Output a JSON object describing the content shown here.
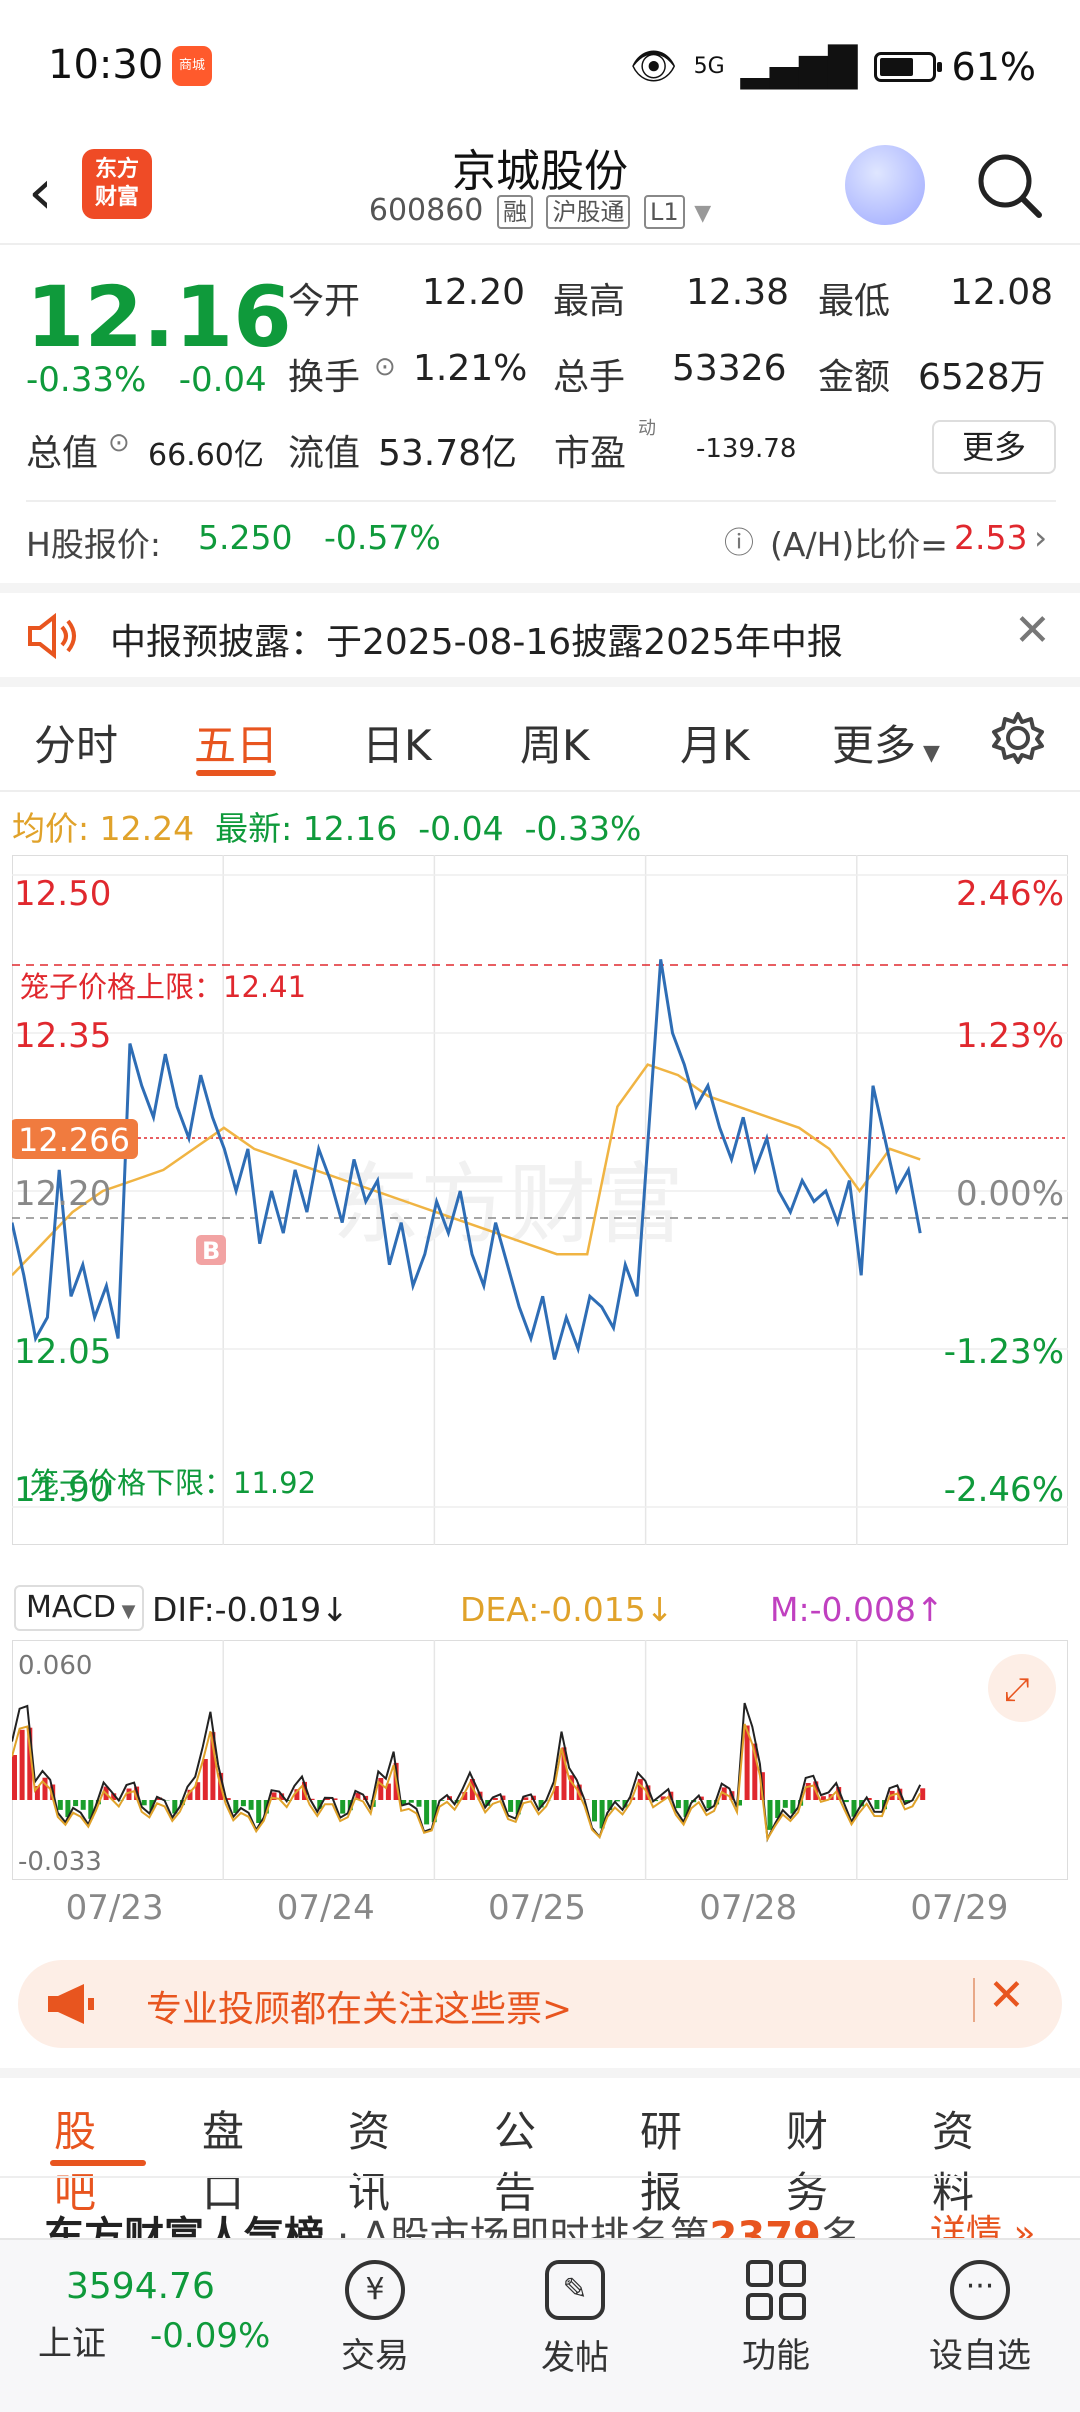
{
  "status": {
    "time": "10:30",
    "app_badge": "商城",
    "network": "5G",
    "battery": "61%"
  },
  "header": {
    "title": "京城股份",
    "code": "600860",
    "tags": [
      "融",
      "沪股通",
      "L1"
    ],
    "logo_text": "东方\n财富"
  },
  "quote": {
    "price": "12.16",
    "change_pct": "-0.33%",
    "change": "-0.04",
    "open_label": "今开",
    "open": "12.20",
    "high_label": "最高",
    "high": "12.38",
    "low_label": "最低",
    "low": "12.08",
    "turnover_label": "换手",
    "turnover": "1.21%",
    "volume_label": "总手",
    "volume": "53326",
    "amount_label": "金额",
    "amount": "6528万",
    "mktcap_label": "总值",
    "mktcap": "66.60亿",
    "float_label": "流值",
    "float_cap": "53.78亿",
    "pe_label": "市盈",
    "pe_sup": "动",
    "pe": "-139.78",
    "more": "更多"
  },
  "hshare": {
    "label": "H股报价:",
    "price": "5.250",
    "change": "-0.57%",
    "ratio_label": "(A/H)比价=",
    "ratio": "2.53"
  },
  "notice": {
    "text": "中报预披露：于2025-08-16披露2025年中报"
  },
  "tabs": {
    "items": [
      "分时",
      "五日",
      "日K",
      "周K",
      "月K",
      "更多"
    ],
    "active": "五日"
  },
  "legend": {
    "avg_label": "均价:",
    "avg": "12.24",
    "latest_label": "最新:",
    "latest": "12.16",
    "chg": "-0.04",
    "chg_pct": "-0.33%"
  },
  "chart_labels": {
    "upper_limit": "笼子价格上限：12.41",
    "lower_limit": "笼子价格下限：11.92",
    "cur_price": "12.266",
    "watermark": "东方财富",
    "buy_marker": "B",
    "macd_select": "MACD",
    "dif": "DIF:-0.019↓",
    "dea": "DEA:-0.015↓",
    "m": "M:-0.008↑"
  },
  "chart_data": {
    "type": "line",
    "title": "",
    "y_left_ticks": [
      "12.50",
      "12.35",
      "12.20",
      "12.05",
      "11.90"
    ],
    "y_right_ticks": [
      "2.46%",
      "1.23%",
      "0.00%",
      "-1.23%",
      "-2.46%"
    ],
    "ylim": [
      11.9,
      12.5
    ],
    "x_ticks": [
      "07/23",
      "07/24",
      "07/25",
      "07/28",
      "07/29"
    ],
    "prev_close": 12.2,
    "series": [
      {
        "values": [
          12.17,
          12.12,
          12.06,
          12.08,
          12.22,
          12.1,
          12.13,
          12.08,
          12.11,
          12.06,
          12.34,
          12.3,
          12.27,
          12.33,
          12.28,
          12.25,
          12.31,
          12.27,
          12.24,
          12.2,
          12.24,
          12.15,
          12.2,
          12.16,
          12.22,
          12.18,
          12.24,
          12.21,
          12.17,
          12.23,
          12.19,
          12.21,
          12.13,
          12.17,
          12.11,
          12.14,
          12.19,
          12.16,
          12.2,
          12.14,
          12.11,
          12.17,
          12.13,
          12.09,
          12.06,
          12.1,
          12.04,
          12.08,
          12.05,
          12.1,
          12.09,
          12.07,
          12.13,
          12.1,
          12.26,
          12.42,
          12.35,
          12.32,
          12.28,
          12.3,
          12.26,
          12.23,
          12.27,
          12.22,
          12.25,
          12.2,
          12.18,
          12.21,
          12.19,
          12.2,
          12.17,
          12.21,
          12.12,
          12.3,
          12.25,
          12.2,
          12.22,
          12.16
        ]
      },
      {
        "values": [
          12.12,
          12.15,
          12.18,
          12.2,
          12.21,
          12.22,
          12.24,
          12.26,
          12.24,
          12.23,
          12.22,
          12.21,
          12.2,
          12.19,
          12.18,
          12.17,
          12.16,
          12.15,
          12.14,
          12.14,
          12.28,
          12.32,
          12.31,
          12.29,
          12.28,
          12.27,
          12.26,
          12.24,
          12.2,
          12.24,
          12.23
        ]
      }
    ]
  },
  "macd_data": {
    "y_top": "0.060",
    "y_bottom": "-0.033"
  },
  "promo": {
    "text": "专业投顾都在关注这些票>"
  },
  "subtabs": {
    "items": [
      "股吧",
      "盘口",
      "资讯",
      "公告",
      "研报",
      "财务",
      "资料"
    ],
    "active": "股吧"
  },
  "ranking": {
    "brand": "东方财富人气榜",
    "text": "A股市场即时排名第",
    "rank": "2379",
    "suffix": "名",
    "detail": "详情"
  },
  "bottom": {
    "index_value": "3594.76",
    "index_name": "上证",
    "index_chg": "-0.09%",
    "items": [
      "交易",
      "发帖",
      "功能",
      "设自选"
    ]
  }
}
